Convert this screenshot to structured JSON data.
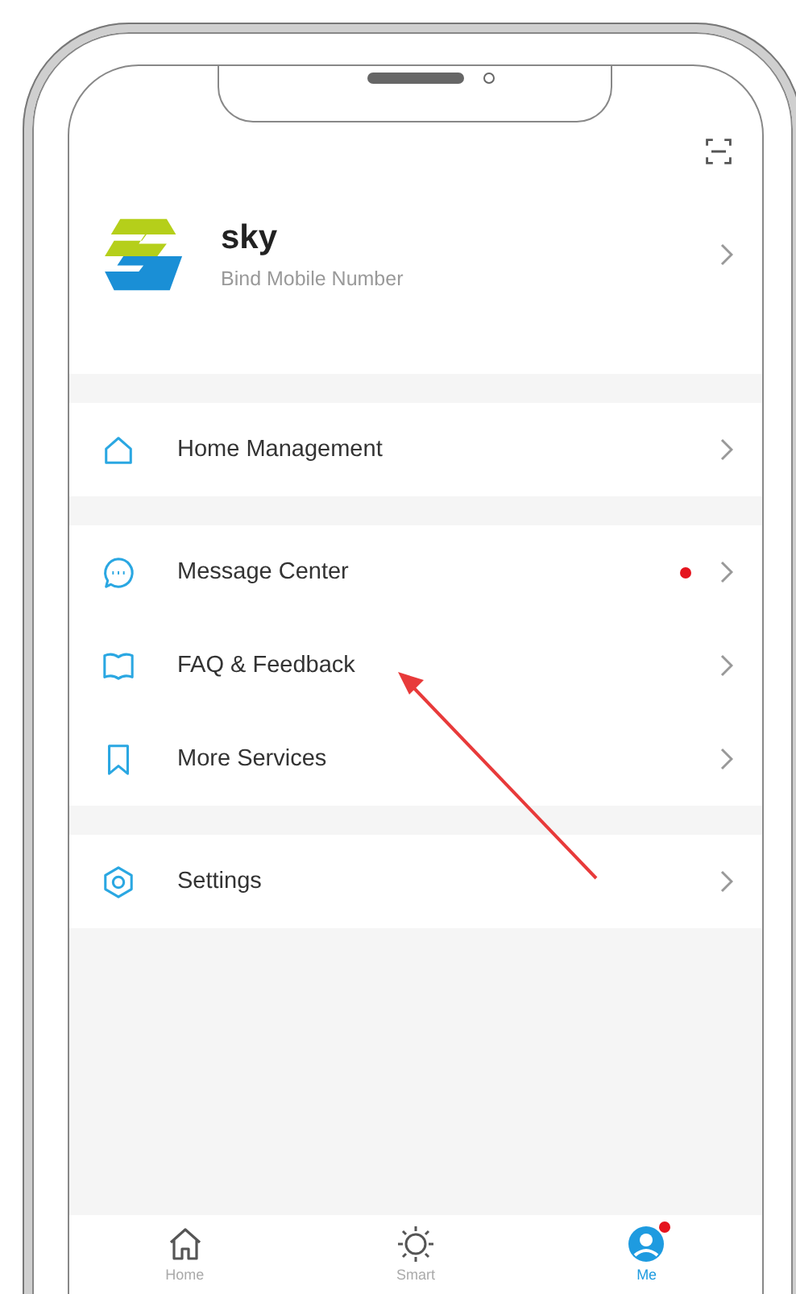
{
  "profile": {
    "name": "sky",
    "subtitle": "Bind Mobile Number"
  },
  "menu_groups": [
    {
      "items": [
        {
          "label": "Home Management",
          "unread_dot": false
        }
      ]
    },
    {
      "items": [
        {
          "label": "Message Center",
          "unread_dot": true
        },
        {
          "label": "FAQ & Feedback",
          "unread_dot": false
        },
        {
          "label": "More Services",
          "unread_dot": false
        }
      ]
    },
    {
      "items": [
        {
          "label": "Settings",
          "unread_dot": false
        }
      ]
    }
  ],
  "tab_bar": [
    {
      "label": "Home",
      "selected": false,
      "badge": false
    },
    {
      "label": "Smart",
      "selected": false,
      "badge": false
    },
    {
      "label": "Me",
      "selected": true,
      "badge": true
    }
  ]
}
